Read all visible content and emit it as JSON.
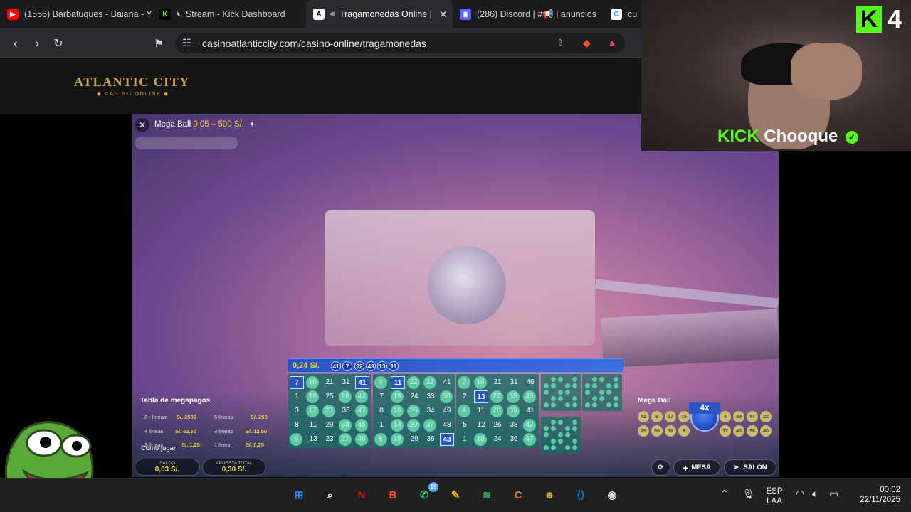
{
  "browser": {
    "tabs": [
      {
        "label": "(1556) Barbatuques - Baiana - Y",
        "favicon": "youtube-icon",
        "color": "#ff0000"
      },
      {
        "label": "Stream - Kick Dashboard",
        "favicon": "kick-icon",
        "color": "#53fc18",
        "muted": true
      },
      {
        "label": "Tragamonedas Online |",
        "favicon": "atlantic-city-icon",
        "color": "#333333",
        "active": true,
        "audio": true
      },
      {
        "label": "(286) Discord | #📢 | anuncios",
        "favicon": "discord-icon",
        "color": "#5865f2",
        "badge": "286"
      },
      {
        "label": "cu",
        "favicon": "google-icon",
        "color": "#ffffff"
      }
    ],
    "url": "casinoatlanticcity.com/casino-online/tragamonedas",
    "brave_badge": "10",
    "alert_badge": "1"
  },
  "site": {
    "logo_main": "ATLANTIC CITY",
    "logo_sub": "◆ CASINO ONLINE ◆"
  },
  "game": {
    "title": "Mega Ball",
    "range": "0,05 – 500 S/.",
    "chat_placeholder": "Chatear",
    "drawn_amount": "0,24 S/.",
    "drawn_balls": [
      "41",
      "7",
      "32",
      "43",
      "13",
      "11"
    ],
    "payouts_title": "Tabla de megapagos",
    "payouts": [
      {
        "lines": "6+ líneas",
        "value": "S/. 2500"
      },
      {
        "lines": "5 líneas",
        "value": "S/. 250"
      },
      {
        "lines": "4 líneas",
        "value": "S/. 62,50"
      },
      {
        "lines": "3 líneas",
        "value": "S/. 12,50"
      },
      {
        "lines": "2 líneas",
        "value": "S/. 1,25"
      },
      {
        "lines": "1 línea",
        "value": "S/. 0,25"
      }
    ],
    "how_to_play": "Cómo jugar",
    "balance_label": "SALDO",
    "balance_value": "0,03 S/.",
    "total_bet_label": "APUESTA TOTAL",
    "total_bet_value": "0,30 S/.",
    "cards": [
      {
        "rows": [
          [
            "7",
            "16",
            "21",
            "31",
            "41"
          ],
          [
            "1",
            "18",
            "25",
            "28",
            "44"
          ],
          [
            "3",
            "17",
            "23",
            "36",
            "47"
          ],
          [
            "8",
            "11",
            "29",
            "38",
            "45"
          ],
          [
            "9",
            "13",
            "23",
            "27",
            "48"
          ]
        ],
        "hits": [
          [
            0,
            1
          ],
          [
            0,
            4
          ],
          [
            1,
            1
          ],
          [
            1,
            3
          ],
          [
            1,
            4
          ],
          [
            2,
            1
          ],
          [
            2,
            2
          ],
          [
            2,
            4
          ],
          [
            3,
            3
          ],
          [
            3,
            4
          ],
          [
            4,
            0
          ],
          [
            4,
            3
          ],
          [
            4,
            4
          ]
        ],
        "selected": [
          [
            0,
            0
          ],
          [
            0,
            4
          ]
        ]
      },
      {
        "rows": [
          [
            "4",
            "11",
            "22",
            "32",
            "41"
          ],
          [
            "7",
            "15",
            "24",
            "33",
            "50"
          ],
          [
            "8",
            "16",
            "20",
            "34",
            "49"
          ],
          [
            "1",
            "14",
            "30",
            "37",
            "48"
          ],
          [
            "6",
            "19",
            "29",
            "36",
            "43"
          ]
        ],
        "hits": [
          [
            0,
            0
          ],
          [
            0,
            2
          ],
          [
            0,
            3
          ],
          [
            1,
            1
          ],
          [
            1,
            4
          ],
          [
            2,
            1
          ],
          [
            2,
            2
          ],
          [
            3,
            1
          ],
          [
            3,
            2
          ],
          [
            3,
            3
          ],
          [
            4,
            0
          ],
          [
            4,
            1
          ]
        ],
        "selected": [
          [
            0,
            1
          ],
          [
            4,
            4
          ]
        ]
      },
      {
        "rows": [
          [
            "2",
            "16",
            "21",
            "31",
            "46"
          ],
          [
            "2",
            "13",
            "27",
            "35",
            "45"
          ],
          [
            "4",
            "11",
            "28",
            "39",
            "41"
          ],
          [
            "5",
            "12",
            "26",
            "38",
            "42"
          ],
          [
            "1",
            "18",
            "24",
            "36",
            "47"
          ]
        ],
        "hits": [
          [
            0,
            0
          ],
          [
            0,
            1
          ],
          [
            1,
            2
          ],
          [
            1,
            3
          ],
          [
            1,
            4
          ],
          [
            2,
            0
          ],
          [
            2,
            2
          ],
          [
            2,
            3
          ],
          [
            3,
            4
          ],
          [
            4,
            1
          ],
          [
            4,
            4
          ]
        ],
        "selected": [
          [
            1,
            1
          ]
        ]
      }
    ],
    "megaball_title": "Mega Ball",
    "megaball_multiplier": "4x",
    "megaball_balls_top": [
      "42",
      "9",
      "17",
      "16",
      "4",
      "39",
      "44",
      "22"
    ],
    "megaball_balls_bottom": [
      "35",
      "50",
      "19",
      "6",
      "37",
      "45",
      "38",
      "40"
    ],
    "btn_mesa": "MESA",
    "btn_salon": "SALÓN"
  },
  "stream": {
    "kick_logo": "K",
    "viewers": "4",
    "streamer_prefix": "KICK",
    "streamer_name": "Chooque"
  },
  "taskbar": {
    "icons": [
      {
        "name": "windows-start-icon",
        "glyph": "⊞",
        "color": "#2b88ff"
      },
      {
        "name": "search-icon",
        "glyph": "⌕",
        "color": "#ffffff"
      },
      {
        "name": "netflix-icon",
        "glyph": "N",
        "color": "#e50914"
      },
      {
        "name": "brave-icon",
        "glyph": "B",
        "color": "#fb542b"
      },
      {
        "name": "whatsapp-icon",
        "glyph": "✆",
        "color": "#25d366",
        "badge": "19"
      },
      {
        "name": "pen-app-icon",
        "glyph": "✎",
        "color": "#f7b500"
      },
      {
        "name": "spotify-icon",
        "glyph": "≋",
        "color": "#1db954"
      },
      {
        "name": "crunchyroll-icon",
        "glyph": "C",
        "color": "#f47521"
      },
      {
        "name": "game-app-icon",
        "glyph": "☻",
        "color": "#e8b23a"
      },
      {
        "name": "vscode-icon",
        "glyph": "⟨⟩",
        "color": "#007acc"
      },
      {
        "name": "obs-icon",
        "glyph": "◉",
        "color": "#dddddd"
      }
    ],
    "lang_top": "ESP",
    "lang_bottom": "LAA",
    "time": "00:02",
    "date": "22/11/2025"
  }
}
